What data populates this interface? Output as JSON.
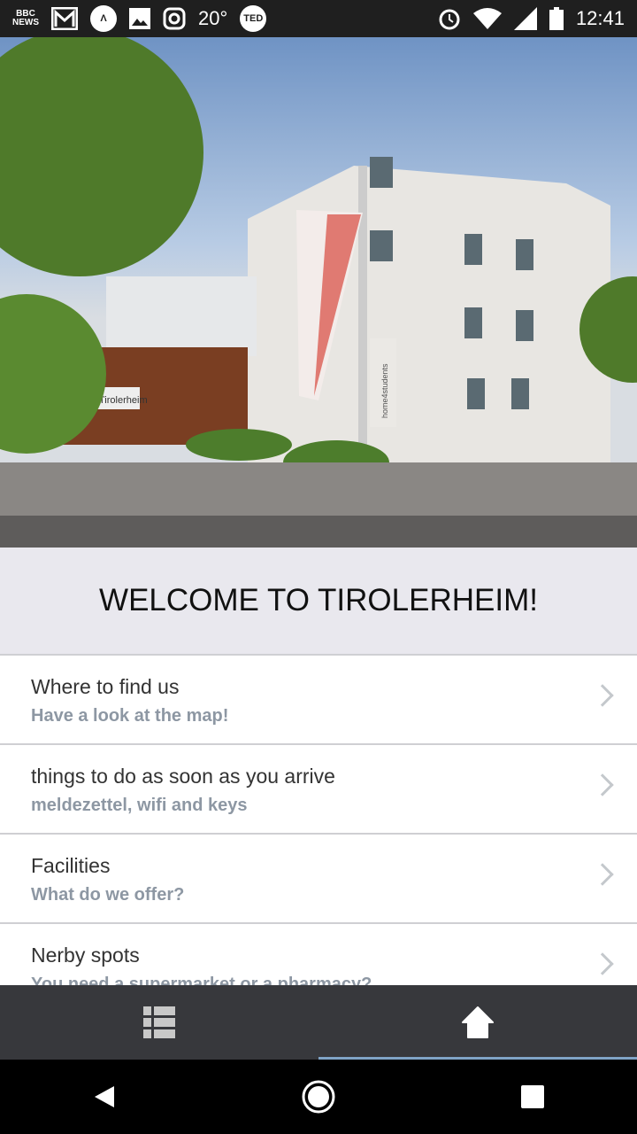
{
  "status_bar": {
    "temperature": "20°",
    "time": "12:41",
    "bbc_line1": "BBC",
    "bbc_line2": "NEWS",
    "ted": "TED",
    "icons": [
      "bbc-news-icon",
      "gmail-icon",
      "arrow-app-icon",
      "gallery-icon",
      "instagram-icon",
      "ted-icon",
      "alarm-icon",
      "wifi-icon",
      "signal-icon",
      "battery-icon"
    ]
  },
  "hero": {
    "sign_text": "Tirolerheim",
    "banner_text": "home4students"
  },
  "welcome": "WELCOME TO TIROLERHEIM!",
  "items": [
    {
      "title": "Where to find us",
      "subtitle": "Have a look at the map!"
    },
    {
      "title": "things to do as soon as you arrive",
      "subtitle": "meldezettel, wifi and keys"
    },
    {
      "title": "Facilities",
      "subtitle": "What do we offer?"
    },
    {
      "title": "Nerby spots",
      "subtitle": "You need a supermarket or a pharmacy?"
    }
  ],
  "tabs": [
    {
      "icon": "list-icon",
      "active": false
    },
    {
      "icon": "home-icon",
      "active": true
    }
  ],
  "colors": {
    "accent": "#7fa3c6",
    "tabbar": "#37383c",
    "subtitle": "#8d97a3"
  }
}
